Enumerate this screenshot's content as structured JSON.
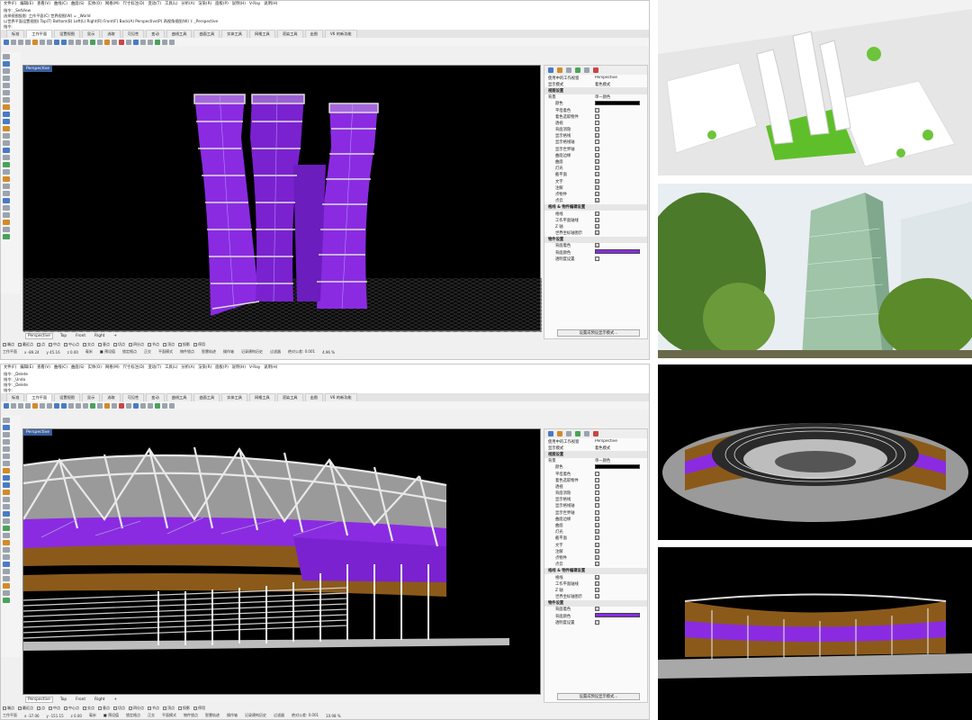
{
  "window1": {
    "menu": [
      "文件(F)",
      "编辑(E)",
      "查看(V)",
      "曲线(C)",
      "曲面(S)",
      "实体(O)",
      "网格(M)",
      "尺寸标注(D)",
      "变动(T)",
      "工具(L)",
      "分析(A)",
      "渲染(R)",
      "面板(P)",
      "说明(H)",
      "V-Ray",
      "说明(H)"
    ],
    "cmd_lines": [
      "指令: _SetView",
      "选择视图投影: 工作平面(C) 世界视图(W) = _World",
      "以世界平面设置视图( Top(T)  Bottom(B)  Left(L)  Right(R)  Front(F)  Back(A)  Perspective(P)  两视角视图(W) ): _Perspective",
      "指令:"
    ],
    "tabs": [
      "标准",
      "工作平面",
      "设置视图",
      "显示",
      "选取",
      "可见性",
      "变动",
      "曲线工具",
      "曲面工具",
      "实体工具",
      "网格工具",
      "渲染工具",
      "出图",
      "V6 的新功能"
    ],
    "viewport_label": "Perspective",
    "viewport_tabs": [
      "Perspective",
      "Top",
      "Front",
      "Right"
    ],
    "osnap": [
      "端点",
      "最近点",
      "点",
      "中点",
      "中心点",
      "交点",
      "垂点",
      "切点",
      "四分点",
      "节点",
      "顶点",
      "投影",
      "停用"
    ],
    "status": [
      "工作平面",
      "x -89.24",
      "y 45.16",
      "z 0.00",
      "毫米",
      "■ 预设值",
      "锁定格点",
      "正交",
      "平面模式",
      "物件锁点",
      "智慧轨迹",
      "操作轴",
      "记录建构历史",
      "过滤器",
      "绝对公差: 0.001",
      "4.96 %"
    ]
  },
  "panel1": {
    "rows": [
      {
        "type": "kv",
        "label": "使用中的工作视窗",
        "value": "Perspective"
      },
      {
        "type": "kv",
        "label": "显示模式",
        "value": "着色模式"
      },
      {
        "type": "sec",
        "label": "视图设置"
      },
      {
        "type": "kv",
        "label": "背景",
        "value": "单一颜色"
      },
      {
        "type": "color",
        "label": "颜色",
        "value": "#000000"
      },
      {
        "type": "check",
        "label": "平坦着色",
        "value": "□"
      },
      {
        "type": "check",
        "label": "着色选取物件",
        "value": "□"
      },
      {
        "type": "check",
        "label": "透视",
        "value": "□"
      },
      {
        "type": "check",
        "label": "背面消隐",
        "value": "□"
      },
      {
        "type": "check",
        "label": "显示格线",
        "value": "☑"
      },
      {
        "type": "check",
        "label": "显示格线轴",
        "value": "□"
      },
      {
        "type": "check",
        "label": "显示世界轴",
        "value": "□"
      },
      {
        "type": "check",
        "label": "曲面边缘",
        "value": "☑"
      },
      {
        "type": "check",
        "label": "曲面",
        "value": "☑"
      },
      {
        "type": "check",
        "label": "灯光",
        "value": "☑"
      },
      {
        "type": "check",
        "label": "截平面",
        "value": "☑"
      },
      {
        "type": "check",
        "label": "文字",
        "value": "☑"
      },
      {
        "type": "check",
        "label": "注解",
        "value": "☑"
      },
      {
        "type": "check",
        "label": "点物件",
        "value": "☑"
      },
      {
        "type": "check",
        "label": "点云",
        "value": "☑"
      },
      {
        "type": "sec",
        "label": "格线 & 物件编辑设置"
      },
      {
        "type": "check",
        "label": "格线",
        "value": "☑"
      },
      {
        "type": "check",
        "label": "工作平面轴线",
        "value": "☑"
      },
      {
        "type": "check",
        "label": "Z 轴",
        "value": "☑"
      },
      {
        "type": "check",
        "label": "世界坐标轴图示",
        "value": "☑"
      },
      {
        "type": "sec",
        "label": "物件设置"
      },
      {
        "type": "check",
        "label": "背面着色",
        "value": "☑"
      },
      {
        "type": "color",
        "label": "背面颜色",
        "value": "#8a2be2"
      },
      {
        "type": "check",
        "label": "透明度设置",
        "value": "□"
      }
    ],
    "button": "设置成预设显示模式..."
  },
  "window2": {
    "menu": [
      "文件(F)",
      "编辑(E)",
      "查看(V)",
      "曲线(C)",
      "曲面(S)",
      "实体(O)",
      "网格(M)",
      "尺寸标注(D)",
      "变动(T)",
      "工具(L)",
      "分析(A)",
      "渲染(R)",
      "面板(P)",
      "说明(H)",
      "V-Ray",
      "说明(H)"
    ],
    "cmd_lines": [
      "指令: _Delete",
      "指令: _Undo",
      "指令: _Delete",
      "指令:"
    ],
    "tabs": [
      "标准",
      "工作平面",
      "设置视图",
      "显示",
      "选取",
      "可见性",
      "变动",
      "曲线工具",
      "曲面工具",
      "实体工具",
      "网格工具",
      "渲染工具",
      "出图",
      "V6 的新功能"
    ],
    "viewport_label": "Perspective",
    "viewport_tabs": [
      "Perspective",
      "Top",
      "Front",
      "Right"
    ],
    "osnap": [
      "端点",
      "最近点",
      "点",
      "中点",
      "中心点",
      "交点",
      "垂点",
      "切点",
      "四分点",
      "节点",
      "顶点",
      "投影",
      "停用"
    ],
    "status": [
      "工作平面",
      "x -37.06",
      "y -151.15",
      "z 0.00",
      "毫米",
      "■ 预设值",
      "锁定格点",
      "正交",
      "平面模式",
      "物件锁点",
      "智慧轨迹",
      "操作轴",
      "记录建构历史",
      "过滤器",
      "绝对公差: 0.001",
      "10.98 %"
    ]
  },
  "panel2": {
    "rows": [
      {
        "type": "kv",
        "label": "使用中的工作视窗",
        "value": "Perspective"
      },
      {
        "type": "kv",
        "label": "显示模式",
        "value": "着色模式"
      },
      {
        "type": "sec",
        "label": "视图设置"
      },
      {
        "type": "kv",
        "label": "背景",
        "value": "单一颜色"
      },
      {
        "type": "color",
        "label": "颜色",
        "value": "#000000"
      },
      {
        "type": "check",
        "label": "平坦着色",
        "value": "□"
      },
      {
        "type": "check",
        "label": "着色选取物件",
        "value": "□"
      },
      {
        "type": "check",
        "label": "透视",
        "value": "□"
      },
      {
        "type": "check",
        "label": "背面消隐",
        "value": "□"
      },
      {
        "type": "check",
        "label": "显示格线",
        "value": "☑"
      },
      {
        "type": "check",
        "label": "显示格线轴",
        "value": "□"
      },
      {
        "type": "check",
        "label": "显示世界轴",
        "value": "□"
      },
      {
        "type": "check",
        "label": "曲面边缘",
        "value": "☑"
      },
      {
        "type": "check",
        "label": "曲面",
        "value": "☑"
      },
      {
        "type": "check",
        "label": "灯光",
        "value": "☑"
      },
      {
        "type": "check",
        "label": "截平面",
        "value": "☑"
      },
      {
        "type": "check",
        "label": "文字",
        "value": "☑"
      },
      {
        "type": "check",
        "label": "注解",
        "value": "☑"
      },
      {
        "type": "check",
        "label": "点物件",
        "value": "☑"
      },
      {
        "type": "check",
        "label": "点云",
        "value": "☑"
      },
      {
        "type": "sec",
        "label": "格线 & 物件编辑设置"
      },
      {
        "type": "check",
        "label": "格线",
        "value": "☑"
      },
      {
        "type": "check",
        "label": "工作平面轴线",
        "value": "☑"
      },
      {
        "type": "check",
        "label": "Z 轴",
        "value": "☑"
      },
      {
        "type": "check",
        "label": "世界坐标轴图示",
        "value": "☑"
      },
      {
        "type": "sec",
        "label": "物件设置"
      },
      {
        "type": "check",
        "label": "背面着色",
        "value": "☑"
      },
      {
        "type": "color",
        "label": "背面颜色",
        "value": "#8a2be2"
      },
      {
        "type": "check",
        "label": "透明度设置",
        "value": "□"
      }
    ],
    "button": "设置成预设显示模式..."
  },
  "colors": {
    "facade_purple": "#8a2be2",
    "facade_brown": "#8b5a1a",
    "viewport_bg": "#000000",
    "label_blue": "#3a5f9e",
    "tree_green": "#5a8a2a"
  },
  "icons": [
    "arrow-icon",
    "curve-icon",
    "circle-icon",
    "rectangle-icon",
    "polygon-icon",
    "surface-icon",
    "box-icon",
    "sphere-icon",
    "extrude-icon",
    "mesh-icon",
    "move-icon",
    "rotate-icon",
    "scale-icon",
    "mirror-icon",
    "join-icon",
    "explode-icon",
    "trim-icon",
    "split-icon",
    "fillet-icon",
    "array-icon",
    "dimension-icon",
    "text-icon",
    "layer-icon",
    "render-icon"
  ]
}
